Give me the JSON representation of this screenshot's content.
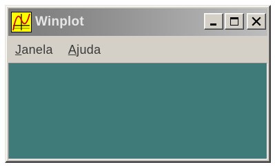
{
  "window": {
    "title": "Winplot",
    "icon": "winplot-graph-icon"
  },
  "title_buttons": {
    "minimize": "minimize-icon",
    "maximize": "maximize-icon",
    "close": "close-icon"
  },
  "menu": {
    "items": [
      {
        "mnemonic": "J",
        "rest": "anela"
      },
      {
        "mnemonic": "A",
        "rest": "juda"
      }
    ]
  },
  "colors": {
    "client_area": "#3f7b78",
    "icon_background": "#ffff00",
    "icon_curve": "#d00000"
  }
}
